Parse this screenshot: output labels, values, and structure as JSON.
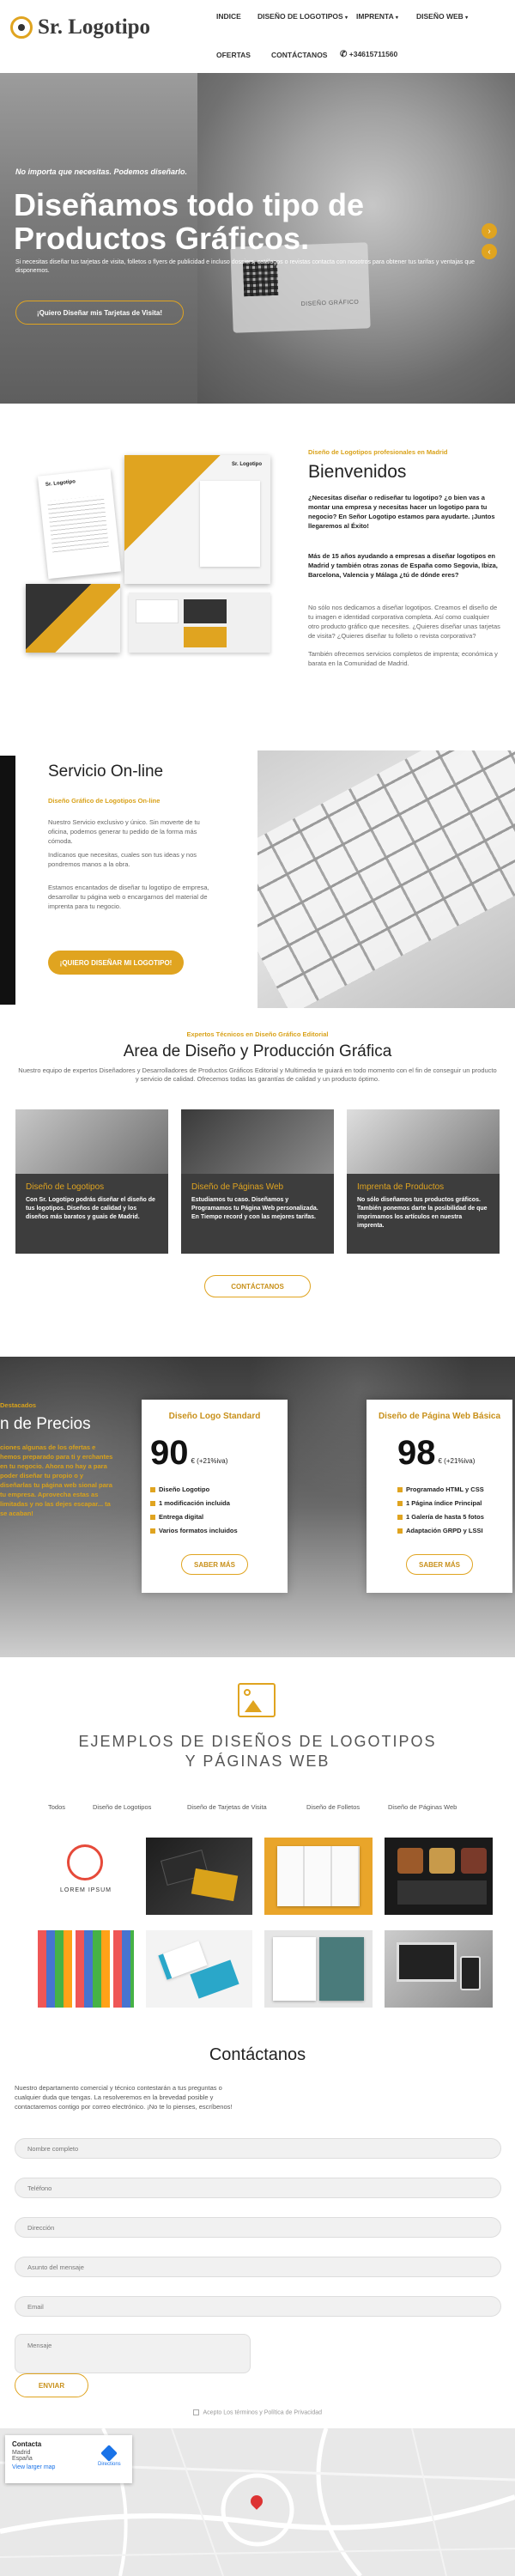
{
  "header": {
    "logo_text": "Sr. Logotipo",
    "nav": [
      "INDICE",
      "DISEÑO DE LOGOTIPOS",
      "IMPRENTA",
      "DISEÑO WEB",
      "OFERTAS",
      "CONTÁCTANOS"
    ],
    "phone": "+34615711560"
  },
  "hero": {
    "kicker": "No importa que necesitas. Podemos diseñarlo.",
    "title_line1": "Diseñamos todo tipo de",
    "title_line2": "Productos Gráficos.",
    "subtitle": "Si necesitas diseñar tus tarjetas de visita, folletos o flyers de publicidad e incluso dossiers, catálogos o revistas contacta con nosotros para obtener tus tarifas y ventajas que disponemos.",
    "cta": "¡Quiero Diseñar mis Tarjetas de Visita!",
    "badge": "DISEÑO GRÁFICO"
  },
  "welcome": {
    "kicker": "Diseño de Logotipos profesionales en Madrid",
    "title": "Bienvenidos",
    "p1": "¿Necesitas diseñar o rediseñar tu logotipo? ¿o bien vas a montar una empresa y necesitas hacer un logotipo para tu negocio? En Señor Logotipo estamos para ayudarte. ¡Juntos llegaremos al Éxito!",
    "p2": "Más de 15 años ayudando a empresas a diseñar logotipos en Madrid y también otras zonas de España como Segovia, Ibiza, Barcelona, Valencia y Málaga ¿tú de dónde eres?",
    "p3": "No sólo nos dedicamos a diseñar logotipos. Creamos el diseño de tu imagen e identidad corporativa completa. Así como cualquier otro producto gráfico que necesites. ¿Quieres diseñar unas tarjetas de visita? ¿Quieres diseñar tu folleto o revista corporativa?",
    "p4": "También ofrecemos servicios completos de imprenta; económica y barata en la Comunidad de Madrid.",
    "mock_logo": "Sr. Logotipo"
  },
  "online": {
    "title": "Servicio On-line",
    "kicker": "Diseño Gráfico de Logotipos On-line",
    "p1": "Nuestro Servicio exclusivo y único. Sin moverte de tu oficina, podemos generar tu pedido de la forma más cómoda.",
    "p2": "Indícanos que necesitas, cuales son tus ideas y nos pondremos manos a la obra.",
    "p3": "Estamos encantados de diseñar tu logotipo de empresa, desarrollar tu página web o encargarnos del material de imprenta para tu negocio.",
    "cta": "¡QUIERO DISEÑAR MI LOGOTIPO!"
  },
  "area": {
    "kicker": "Expertos Técnicos en Diseño Gráfico Editorial",
    "title": "Area de Diseño y Producción Gráfica",
    "intro": "Nuestro equipo de expertos Diseñadores y Desarrolladores de Productos Gráficos Editorial y Multimedia te guiará en todo momento con el fin de conseguir un producto y servicio de calidad. Ofrecemos todas las garantías de calidad y un producto óptimo.",
    "cards": [
      {
        "title": "Diseño de Logotipos",
        "text": "Con Sr. Logotipo podrás diseñar el diseño de tus logotipos. Diseños de calidad y los diseños más baratos y guais de Madrid."
      },
      {
        "title": "Diseño de Páginas Web",
        "text": "Estudiamos tu caso. Diseñamos y Programamos tu Página Web personalizada. En Tiempo record y con las mejores tarifas."
      },
      {
        "title": "Imprenta de Productos",
        "text": "No sólo diseñamos tus productos gráficos. También ponemos darte la posibilidad de que imprimamos los artículos en nuestra imprenta."
      }
    ],
    "cta": "CONTÁCTANOS"
  },
  "pricing": {
    "side_kicker": "Destacados",
    "side_title": "n de Precios",
    "side_text": "ciones algunas de los ofertas e hemos preparado para ti y erchantes en tu negocio. Ahora no hay a para poder diseñar tu propio o y diseñarlas tu página web sional para tu empresa. Aprovecha estas as limitadas y no las dejes escapar... ta se acaban!",
    "plans": [
      {
        "title": "Diseño Logo Standard",
        "price": "90",
        "unit": "€ (+21%iva)",
        "features": [
          "Diseño Logotipo",
          "1 modificación incluida",
          "Entrega digital",
          "Varios formatos incluidos"
        ],
        "cta": "SABER MÁS"
      },
      {
        "title": "Diseño de Página Web Básica",
        "price": "98",
        "unit": "€ (+21%iva)",
        "features": [
          "Programado HTML y CSS",
          "1 Página índice Principal",
          "1 Galería de hasta 5 fotos",
          "Adaptación GRPD y LSSI"
        ],
        "cta": "SABER MÁS"
      }
    ]
  },
  "portfolio": {
    "title_line1": "EJEMPLOS DE DISEÑOS DE LOGOTIPOS",
    "title_line2": "Y PÁGINAS WEB",
    "filters": [
      "Todos",
      "Diseño de Logotipos",
      "Diseño de Tarjetas de Visita",
      "Diseño de Folletos",
      "Diseño de Páginas Web"
    ],
    "logo_caption": "LOREM IPSUM"
  },
  "contact": {
    "title": "Contáctanos",
    "intro": "Nuestro departamento comercial y técnico contestarán a tus preguntas o cualquier duda que tengas. La resolveremos en la brevedad posible y contactaremos contigo por correo electrónico. ¡No te lo pienses, escríbenos!",
    "fields": [
      "Nombre completo",
      "Teléfono",
      "Dirección",
      "Asunto del mensaje",
      "Email"
    ],
    "message": "Mensaje",
    "submit": "ENVIAR",
    "legal": "Acepto Los términos y Política de Privacidad"
  },
  "map": {
    "title": "Contacta",
    "line1": "Madrid",
    "line2": "España",
    "link": "View larger map",
    "directions": "Directions"
  }
}
